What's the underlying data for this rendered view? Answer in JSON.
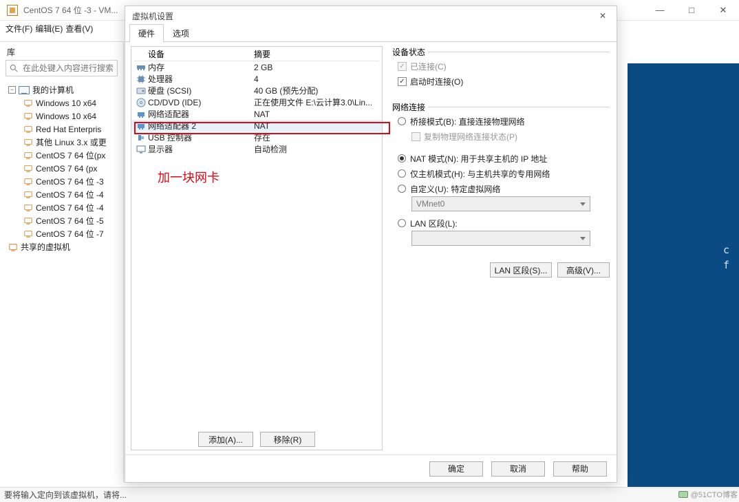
{
  "outer": {
    "title": "CentOS 7 64 位 -3 - VM...",
    "menubar": [
      "文件(F)",
      "编辑(E)",
      "查看(V)"
    ],
    "win_buttons": {
      "min": "—",
      "max": "□",
      "close": "✕"
    }
  },
  "sidebar": {
    "label": "库",
    "search_placeholder": "在此处键入内容进行搜索",
    "root": "我的计算机",
    "items": [
      "Windows 10 x64",
      "Windows 10 x64",
      "Red Hat Enterpris",
      "其他 Linux 3.x 或更",
      "CentOS 7 64 位(px",
      "CentOS 7 64  (px",
      "CentOS 7 64 位 -3",
      "CentOS 7 64 位 -4",
      "CentOS 7 64 位 -4",
      "CentOS 7 64 位 -5",
      "CentOS 7 64 位 -7"
    ],
    "root2": "共享的虚拟机"
  },
  "statusbar": "要将输入定向到该虚拟机，请将...",
  "dialog": {
    "title": "虚拟机设置",
    "tabs": [
      "硬件",
      "选项"
    ],
    "active_tab": 0,
    "hw_headers": {
      "device": "设备",
      "summary": "摘要"
    },
    "hw_rows": [
      {
        "icon": "mem",
        "device": "内存",
        "summary": "2 GB"
      },
      {
        "icon": "cpu",
        "device": "处理器",
        "summary": "4"
      },
      {
        "icon": "disk",
        "device": "硬盘 (SCSI)",
        "summary": "40 GB (预先分配)"
      },
      {
        "icon": "cd",
        "device": "CD/DVD (IDE)",
        "summary": "正在使用文件 E:\\云计算3.0\\Lin..."
      },
      {
        "icon": "net",
        "device": "网络适配器",
        "summary": "NAT"
      },
      {
        "icon": "net",
        "device": "网络适配器 2",
        "summary": "NAT",
        "selected": true
      },
      {
        "icon": "usb",
        "device": "USB 控制器",
        "summary": "存在"
      },
      {
        "icon": "disp",
        "device": "显示器",
        "summary": "自动检测"
      }
    ],
    "hw_buttons": {
      "add": "添加(A)...",
      "remove": "移除(R)"
    },
    "annotation": "加一块网卡",
    "settings": {
      "device_state_label": "设备状态",
      "connected": "已连接(C)",
      "connect_at_power_on": "启动时连接(O)",
      "net_label": "网络连接",
      "bridged": "桥接模式(B): 直接连接物理网络",
      "replicate": "复制物理网络连接状态(P)",
      "nat": "NAT 模式(N): 用于共享主机的 IP 地址",
      "hostonly": "仅主机模式(H): 与主机共享的专用网络",
      "custom": "自定义(U): 特定虚拟网络",
      "vmnet": "VMnet0",
      "lan": "LAN 区段(L):",
      "lan_button": "LAN 区段(S)...",
      "adv_button": "高级(V)..."
    },
    "footer": {
      "ok": "确定",
      "cancel": "取消",
      "help": "帮助"
    }
  },
  "rightstrip": {
    "snip": "c\nf"
  },
  "watermark": "@51CTO博客"
}
